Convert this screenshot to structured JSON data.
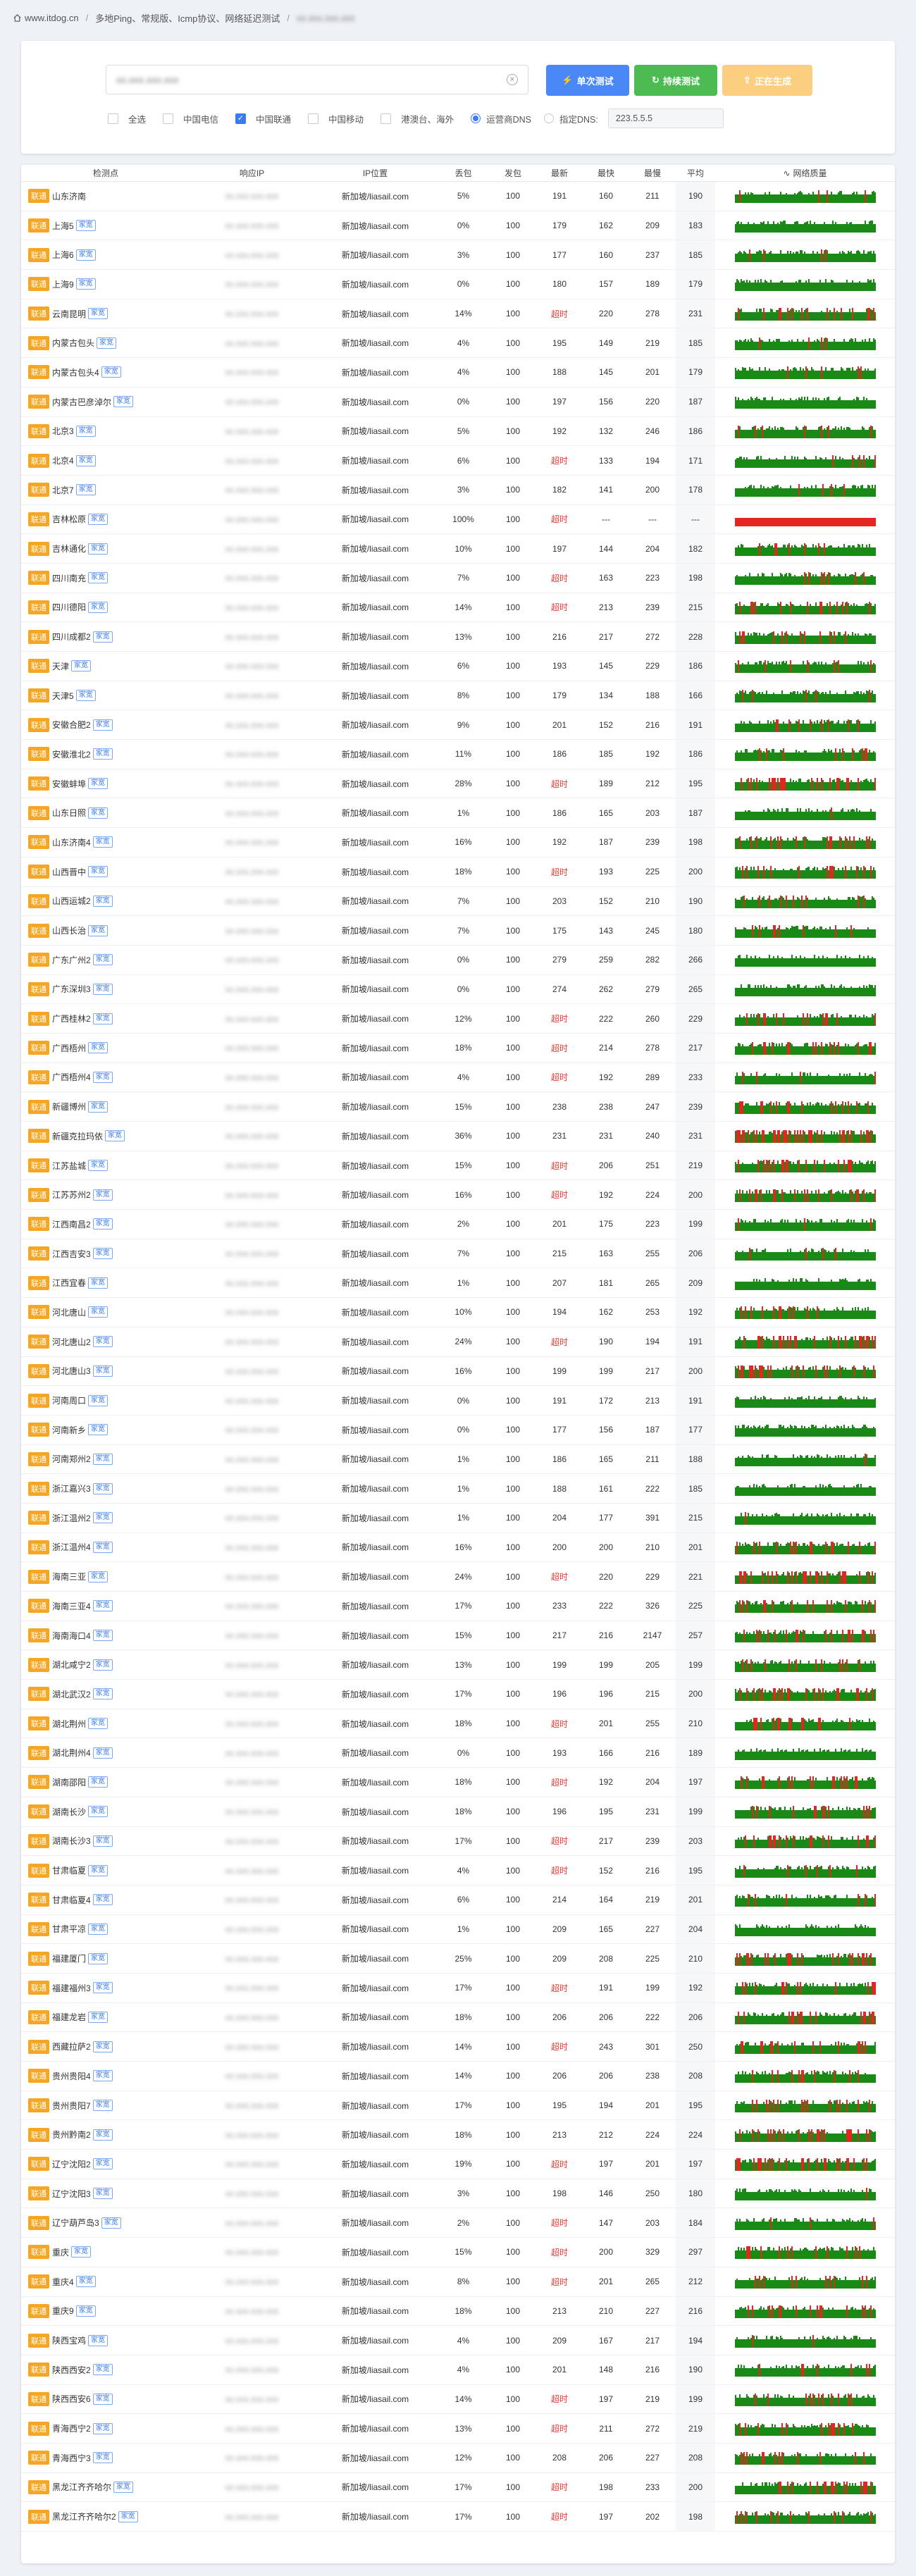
{
  "breadcrumb": {
    "site": "www.itdog.cn",
    "page": "多地Ping、常规版、Icmp协议、网络延迟测试",
    "target": "xx.xxx.xxx.xxx"
  },
  "search": {
    "value": "xx.xxx.xxx.xxx",
    "clear_icon": "clear-circle-icon"
  },
  "buttons": {
    "single": "单次测试",
    "continuous": "持续测试",
    "generating": "正在生成"
  },
  "filters": {
    "all": "全选",
    "telecom": "中国电信",
    "unicom": "中国联通",
    "mobile": "中国移动",
    "overseas": "港澳台、海外"
  },
  "filter_state": {
    "all": false,
    "telecom": false,
    "unicom": true,
    "mobile": false,
    "overseas": false
  },
  "dns": {
    "operator_label": "运营商DNS",
    "custom_label": "指定DNS:",
    "custom_value": "223.5.5.5",
    "selected": "operator"
  },
  "table": {
    "headers": [
      "检测点",
      "响应IP",
      "IP位置",
      "丢包",
      "发包",
      "最新",
      "最快",
      "最慢",
      "平均",
      "网络质量"
    ],
    "isp_label": "联通",
    "tag_label": "家宽",
    "ip_value": "xx.xxx.xxx.xxx",
    "location": "新加坡/liasail.com",
    "timeout_label": "超时",
    "dash": "---",
    "rows": [
      {
        "name": "山东济南",
        "tag": false,
        "loss": "5%",
        "sent": "100",
        "latest": "191",
        "fast": "160",
        "slow": "211",
        "avg": "190",
        "q": 0.05
      },
      {
        "name": "上海5",
        "tag": true,
        "loss": "0%",
        "sent": "100",
        "latest": "179",
        "fast": "162",
        "slow": "209",
        "avg": "183",
        "q": 0
      },
      {
        "name": "上海6",
        "tag": true,
        "loss": "3%",
        "sent": "100",
        "latest": "177",
        "fast": "160",
        "slow": "237",
        "avg": "185",
        "q": 0.03
      },
      {
        "name": "上海9",
        "tag": true,
        "loss": "0%",
        "sent": "100",
        "latest": "180",
        "fast": "157",
        "slow": "189",
        "avg": "179",
        "q": 0
      },
      {
        "name": "云南昆明",
        "tag": true,
        "loss": "14%",
        "sent": "100",
        "latest": "超时",
        "fast": "220",
        "slow": "278",
        "avg": "231",
        "q": 0.14
      },
      {
        "name": "内蒙古包头",
        "tag": true,
        "loss": "4%",
        "sent": "100",
        "latest": "195",
        "fast": "149",
        "slow": "219",
        "avg": "185",
        "q": 0.04
      },
      {
        "name": "内蒙古包头4",
        "tag": true,
        "loss": "4%",
        "sent": "100",
        "latest": "188",
        "fast": "145",
        "slow": "201",
        "avg": "179",
        "q": 0.04
      },
      {
        "name": "内蒙古巴彦淖尔",
        "tag": true,
        "loss": "0%",
        "sent": "100",
        "latest": "197",
        "fast": "156",
        "slow": "220",
        "avg": "187",
        "q": 0
      },
      {
        "name": "北京3",
        "tag": true,
        "loss": "5%",
        "sent": "100",
        "latest": "192",
        "fast": "132",
        "slow": "246",
        "avg": "186",
        "q": 0.05
      },
      {
        "name": "北京4",
        "tag": true,
        "loss": "6%",
        "sent": "100",
        "latest": "超时",
        "fast": "133",
        "slow": "194",
        "avg": "171",
        "q": 0.06
      },
      {
        "name": "北京7",
        "tag": true,
        "loss": "3%",
        "sent": "100",
        "latest": "182",
        "fast": "141",
        "slow": "200",
        "avg": "178",
        "q": 0.03
      },
      {
        "name": "吉林松原",
        "tag": true,
        "loss": "100%",
        "sent": "100",
        "latest": "超时",
        "fast": "---",
        "slow": "---",
        "avg": "---",
        "q": 1
      },
      {
        "name": "吉林通化",
        "tag": true,
        "loss": "10%",
        "sent": "100",
        "latest": "197",
        "fast": "144",
        "slow": "204",
        "avg": "182",
        "q": 0.1
      },
      {
        "name": "四川南充",
        "tag": true,
        "loss": "7%",
        "sent": "100",
        "latest": "超时",
        "fast": "163",
        "slow": "223",
        "avg": "198",
        "q": 0.07
      },
      {
        "name": "四川德阳",
        "tag": true,
        "loss": "14%",
        "sent": "100",
        "latest": "超时",
        "fast": "213",
        "slow": "239",
        "avg": "215",
        "q": 0.14
      },
      {
        "name": "四川成都2",
        "tag": true,
        "loss": "13%",
        "sent": "100",
        "latest": "216",
        "fast": "217",
        "slow": "272",
        "avg": "228",
        "q": 0.13
      },
      {
        "name": "天津",
        "tag": true,
        "loss": "6%",
        "sent": "100",
        "latest": "193",
        "fast": "145",
        "slow": "229",
        "avg": "186",
        "q": 0.06
      },
      {
        "name": "天津5",
        "tag": true,
        "loss": "8%",
        "sent": "100",
        "latest": "179",
        "fast": "134",
        "slow": "188",
        "avg": "166",
        "q": 0.08
      },
      {
        "name": "安徽合肥2",
        "tag": true,
        "loss": "9%",
        "sent": "100",
        "latest": "201",
        "fast": "152",
        "slow": "216",
        "avg": "191",
        "q": 0.09
      },
      {
        "name": "安徽淮北2",
        "tag": true,
        "loss": "11%",
        "sent": "100",
        "latest": "186",
        "fast": "185",
        "slow": "192",
        "avg": "186",
        "q": 0.11
      },
      {
        "name": "安徽蚌埠",
        "tag": true,
        "loss": "28%",
        "sent": "100",
        "latest": "超时",
        "fast": "189",
        "slow": "212",
        "avg": "195",
        "q": 0.28
      },
      {
        "name": "山东日照",
        "tag": true,
        "loss": "1%",
        "sent": "100",
        "latest": "186",
        "fast": "165",
        "slow": "203",
        "avg": "187",
        "q": 0.01
      },
      {
        "name": "山东济南4",
        "tag": true,
        "loss": "16%",
        "sent": "100",
        "latest": "192",
        "fast": "187",
        "slow": "239",
        "avg": "198",
        "q": 0.16
      },
      {
        "name": "山西晋中",
        "tag": true,
        "loss": "18%",
        "sent": "100",
        "latest": "超时",
        "fast": "193",
        "slow": "225",
        "avg": "200",
        "q": 0.18
      },
      {
        "name": "山西运城2",
        "tag": true,
        "loss": "7%",
        "sent": "100",
        "latest": "203",
        "fast": "152",
        "slow": "210",
        "avg": "190",
        "q": 0.07
      },
      {
        "name": "山西长治",
        "tag": true,
        "loss": "7%",
        "sent": "100",
        "latest": "175",
        "fast": "143",
        "slow": "245",
        "avg": "180",
        "q": 0.07
      },
      {
        "name": "广东广州2",
        "tag": true,
        "loss": "0%",
        "sent": "100",
        "latest": "279",
        "fast": "259",
        "slow": "282",
        "avg": "266",
        "q": 0
      },
      {
        "name": "广东深圳3",
        "tag": true,
        "loss": "0%",
        "sent": "100",
        "latest": "274",
        "fast": "262",
        "slow": "279",
        "avg": "265",
        "q": 0
      },
      {
        "name": "广西桂林2",
        "tag": true,
        "loss": "12%",
        "sent": "100",
        "latest": "超时",
        "fast": "222",
        "slow": "260",
        "avg": "229",
        "q": 0.12
      },
      {
        "name": "广西梧州",
        "tag": true,
        "loss": "18%",
        "sent": "100",
        "latest": "超时",
        "fast": "214",
        "slow": "278",
        "avg": "217",
        "q": 0.18
      },
      {
        "name": "广西梧州4",
        "tag": true,
        "loss": "4%",
        "sent": "100",
        "latest": "超时",
        "fast": "192",
        "slow": "289",
        "avg": "233",
        "q": 0.04
      },
      {
        "name": "新疆博州",
        "tag": true,
        "loss": "15%",
        "sent": "100",
        "latest": "238",
        "fast": "238",
        "slow": "247",
        "avg": "239",
        "q": 0.15
      },
      {
        "name": "新疆克拉玛依",
        "tag": true,
        "loss": "36%",
        "sent": "100",
        "latest": "231",
        "fast": "231",
        "slow": "240",
        "avg": "231",
        "q": 0.36
      },
      {
        "name": "江苏盐城",
        "tag": true,
        "loss": "15%",
        "sent": "100",
        "latest": "超时",
        "fast": "206",
        "slow": "251",
        "avg": "219",
        "q": 0.15
      },
      {
        "name": "江苏苏州2",
        "tag": true,
        "loss": "16%",
        "sent": "100",
        "latest": "超时",
        "fast": "192",
        "slow": "224",
        "avg": "200",
        "q": 0.16
      },
      {
        "name": "江西南昌2",
        "tag": true,
        "loss": "2%",
        "sent": "100",
        "latest": "201",
        "fast": "175",
        "slow": "223",
        "avg": "199",
        "q": 0.02
      },
      {
        "name": "江西吉安3",
        "tag": true,
        "loss": "7%",
        "sent": "100",
        "latest": "215",
        "fast": "163",
        "slow": "255",
        "avg": "206",
        "q": 0.07
      },
      {
        "name": "江西宜春",
        "tag": true,
        "loss": "1%",
        "sent": "100",
        "latest": "207",
        "fast": "181",
        "slow": "265",
        "avg": "209",
        "q": 0.01
      },
      {
        "name": "河北唐山",
        "tag": true,
        "loss": "10%",
        "sent": "100",
        "latest": "194",
        "fast": "162",
        "slow": "253",
        "avg": "192",
        "q": 0.1
      },
      {
        "name": "河北唐山2",
        "tag": true,
        "loss": "24%",
        "sent": "100",
        "latest": "超时",
        "fast": "190",
        "slow": "194",
        "avg": "191",
        "q": 0.24
      },
      {
        "name": "河北唐山3",
        "tag": true,
        "loss": "16%",
        "sent": "100",
        "latest": "199",
        "fast": "199",
        "slow": "217",
        "avg": "200",
        "q": 0.16
      },
      {
        "name": "河南周口",
        "tag": true,
        "loss": "0%",
        "sent": "100",
        "latest": "191",
        "fast": "172",
        "slow": "213",
        "avg": "191",
        "q": 0
      },
      {
        "name": "河南新乡",
        "tag": true,
        "loss": "0%",
        "sent": "100",
        "latest": "177",
        "fast": "156",
        "slow": "187",
        "avg": "177",
        "q": 0
      },
      {
        "name": "河南郑州2",
        "tag": true,
        "loss": "1%",
        "sent": "100",
        "latest": "186",
        "fast": "165",
        "slow": "211",
        "avg": "188",
        "q": 0.01
      },
      {
        "name": "浙江嘉兴3",
        "tag": true,
        "loss": "1%",
        "sent": "100",
        "latest": "188",
        "fast": "161",
        "slow": "222",
        "avg": "185",
        "q": 0.01
      },
      {
        "name": "浙江温州2",
        "tag": true,
        "loss": "1%",
        "sent": "100",
        "latest": "204",
        "fast": "177",
        "slow": "391",
        "avg": "215",
        "q": 0.01
      },
      {
        "name": "浙江温州4",
        "tag": true,
        "loss": "16%",
        "sent": "100",
        "latest": "200",
        "fast": "200",
        "slow": "210",
        "avg": "201",
        "q": 0.16
      },
      {
        "name": "海南三亚",
        "tag": true,
        "loss": "24%",
        "sent": "100",
        "latest": "超时",
        "fast": "220",
        "slow": "229",
        "avg": "221",
        "q": 0.24
      },
      {
        "name": "海南三亚4",
        "tag": true,
        "loss": "17%",
        "sent": "100",
        "latest": "233",
        "fast": "222",
        "slow": "326",
        "avg": "225",
        "q": 0.17
      },
      {
        "name": "海南海口4",
        "tag": true,
        "loss": "15%",
        "sent": "100",
        "latest": "217",
        "fast": "216",
        "slow": "2147",
        "avg": "257",
        "q": 0.15
      },
      {
        "name": "湖北咸宁2",
        "tag": true,
        "loss": "13%",
        "sent": "100",
        "latest": "199",
        "fast": "199",
        "slow": "205",
        "avg": "199",
        "q": 0.13
      },
      {
        "name": "湖北武汉2",
        "tag": true,
        "loss": "17%",
        "sent": "100",
        "latest": "196",
        "fast": "196",
        "slow": "215",
        "avg": "200",
        "q": 0.17
      },
      {
        "name": "湖北荆州",
        "tag": true,
        "loss": "18%",
        "sent": "100",
        "latest": "超时",
        "fast": "201",
        "slow": "255",
        "avg": "210",
        "q": 0.18
      },
      {
        "name": "湖北荆州4",
        "tag": true,
        "loss": "0%",
        "sent": "100",
        "latest": "193",
        "fast": "166",
        "slow": "216",
        "avg": "189",
        "q": 0
      },
      {
        "name": "湖南邵阳",
        "tag": true,
        "loss": "18%",
        "sent": "100",
        "latest": "超时",
        "fast": "192",
        "slow": "204",
        "avg": "197",
        "q": 0.18
      },
      {
        "name": "湖南长沙",
        "tag": true,
        "loss": "18%",
        "sent": "100",
        "latest": "196",
        "fast": "195",
        "slow": "231",
        "avg": "199",
        "q": 0.18
      },
      {
        "name": "湖南长沙3",
        "tag": true,
        "loss": "17%",
        "sent": "100",
        "latest": "超时",
        "fast": "217",
        "slow": "239",
        "avg": "203",
        "q": 0.17
      },
      {
        "name": "甘肃临夏",
        "tag": true,
        "loss": "4%",
        "sent": "100",
        "latest": "超时",
        "fast": "152",
        "slow": "216",
        "avg": "195",
        "q": 0.04
      },
      {
        "name": "甘肃临夏4",
        "tag": true,
        "loss": "6%",
        "sent": "100",
        "latest": "214",
        "fast": "164",
        "slow": "219",
        "avg": "201",
        "q": 0.06
      },
      {
        "name": "甘肃平凉",
        "tag": true,
        "loss": "1%",
        "sent": "100",
        "latest": "209",
        "fast": "165",
        "slow": "227",
        "avg": "204",
        "q": 0.01
      },
      {
        "name": "福建厦门",
        "tag": true,
        "loss": "25%",
        "sent": "100",
        "latest": "209",
        "fast": "208",
        "slow": "225",
        "avg": "210",
        "q": 0.25
      },
      {
        "name": "福建福州3",
        "tag": true,
        "loss": "17%",
        "sent": "100",
        "latest": "超时",
        "fast": "191",
        "slow": "199",
        "avg": "192",
        "q": 0.17
      },
      {
        "name": "福建龙岩",
        "tag": true,
        "loss": "18%",
        "sent": "100",
        "latest": "206",
        "fast": "206",
        "slow": "222",
        "avg": "206",
        "q": 0.18
      },
      {
        "name": "西藏拉萨2",
        "tag": true,
        "loss": "14%",
        "sent": "100",
        "latest": "超时",
        "fast": "243",
        "slow": "301",
        "avg": "250",
        "q": 0.14
      },
      {
        "name": "贵州贵阳4",
        "tag": true,
        "loss": "14%",
        "sent": "100",
        "latest": "206",
        "fast": "206",
        "slow": "238",
        "avg": "208",
        "q": 0.14
      },
      {
        "name": "贵州贵阳7",
        "tag": true,
        "loss": "17%",
        "sent": "100",
        "latest": "195",
        "fast": "194",
        "slow": "201",
        "avg": "195",
        "q": 0.17
      },
      {
        "name": "贵州黔南2",
        "tag": true,
        "loss": "18%",
        "sent": "100",
        "latest": "213",
        "fast": "212",
        "slow": "224",
        "avg": "224",
        "q": 0.18
      },
      {
        "name": "辽宁沈阳2",
        "tag": true,
        "loss": "19%",
        "sent": "100",
        "latest": "超时",
        "fast": "197",
        "slow": "201",
        "avg": "197",
        "q": 0.19
      },
      {
        "name": "辽宁沈阳3",
        "tag": true,
        "loss": "3%",
        "sent": "100",
        "latest": "198",
        "fast": "146",
        "slow": "250",
        "avg": "180",
        "q": 0.03
      },
      {
        "name": "辽宁葫芦岛3",
        "tag": true,
        "loss": "2%",
        "sent": "100",
        "latest": "超时",
        "fast": "147",
        "slow": "203",
        "avg": "184",
        "q": 0.02
      },
      {
        "name": "重庆",
        "tag": true,
        "loss": "15%",
        "sent": "100",
        "latest": "超时",
        "fast": "200",
        "slow": "329",
        "avg": "297",
        "q": 0.15
      },
      {
        "name": "重庆4",
        "tag": true,
        "loss": "8%",
        "sent": "100",
        "latest": "超时",
        "fast": "201",
        "slow": "265",
        "avg": "212",
        "q": 0.08
      },
      {
        "name": "重庆9",
        "tag": true,
        "loss": "18%",
        "sent": "100",
        "latest": "213",
        "fast": "210",
        "slow": "227",
        "avg": "216",
        "q": 0.18
      },
      {
        "name": "陕西宝鸡",
        "tag": true,
        "loss": "4%",
        "sent": "100",
        "latest": "209",
        "fast": "167",
        "slow": "217",
        "avg": "194",
        "q": 0.04
      },
      {
        "name": "陕西西安2",
        "tag": true,
        "loss": "4%",
        "sent": "100",
        "latest": "201",
        "fast": "148",
        "slow": "216",
        "avg": "190",
        "q": 0.04
      },
      {
        "name": "陕西西安6",
        "tag": true,
        "loss": "14%",
        "sent": "100",
        "latest": "超时",
        "fast": "197",
        "slow": "219",
        "avg": "199",
        "q": 0.14
      },
      {
        "name": "青海西宁2",
        "tag": true,
        "loss": "13%",
        "sent": "100",
        "latest": "超时",
        "fast": "211",
        "slow": "272",
        "avg": "219",
        "q": 0.13
      },
      {
        "name": "青海西宁3",
        "tag": true,
        "loss": "12%",
        "sent": "100",
        "latest": "208",
        "fast": "206",
        "slow": "227",
        "avg": "208",
        "q": 0.12
      },
      {
        "name": "黑龙江齐齐哈尔",
        "tag": true,
        "loss": "17%",
        "sent": "100",
        "latest": "超时",
        "fast": "198",
        "slow": "233",
        "avg": "200",
        "q": 0.17
      },
      {
        "name": "黑龙江齐齐哈尔2",
        "tag": true,
        "loss": "17%",
        "sent": "100",
        "latest": "超时",
        "fast": "197",
        "slow": "202",
        "avg": "198",
        "q": 0.17
      }
    ]
  },
  "colors": {
    "isp": "#f6a623",
    "ok": "#1a8a16",
    "loss": "#e52620",
    "blue": "#3a7bef",
    "green": "#4cbb52",
    "orange": "#fbcf7f"
  }
}
